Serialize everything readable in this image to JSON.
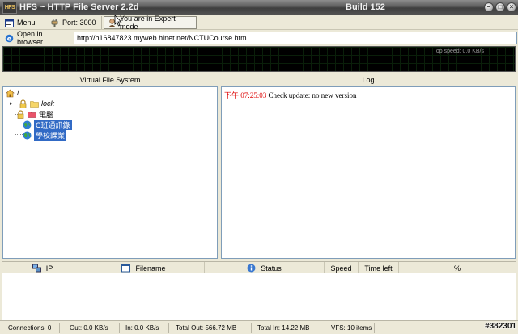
{
  "window": {
    "app_icon_text": "HFS",
    "title": "HFS ~ HTTP File Server 2.2d",
    "build": "Build 152"
  },
  "toolbar": {
    "menu_label": "Menu",
    "port_label": "Port: 3000",
    "mode_label": "You are in Expert mode"
  },
  "urlbar": {
    "open_label": "Open in browser",
    "url_value": "http://h16847823.myweb.hinet.net/NCTUCourse.htm"
  },
  "graph": {
    "speed_text": "Top speed: 0.0 KB/s"
  },
  "vfs": {
    "header": "Virtual File System",
    "root": "/",
    "items": [
      {
        "label": "lock",
        "icon": "locked-folder-icon",
        "italic": true,
        "selected": false
      },
      {
        "label": "電腦",
        "icon": "locked-folder-red-icon",
        "italic": false,
        "selected": false
      },
      {
        "label": "C班通訊錄",
        "icon": "globe-icon",
        "italic": false,
        "selected": true
      },
      {
        "label": "學校課業",
        "icon": "globe-icon",
        "italic": false,
        "selected": true
      }
    ]
  },
  "log": {
    "header": "Log",
    "entries": [
      {
        "time": "下午 07:25:03",
        "message": "Check update: no new version"
      }
    ]
  },
  "connections": {
    "columns": [
      {
        "label": "IP",
        "icon": "network-icon"
      },
      {
        "label": "Filename",
        "icon": "file-window-icon"
      },
      {
        "label": "Status",
        "icon": "info-icon"
      },
      {
        "label": "Speed",
        "icon": ""
      },
      {
        "label": "Time left",
        "icon": ""
      },
      {
        "label": "%",
        "icon": ""
      }
    ]
  },
  "statusbar": {
    "connections": "Connections: 0",
    "out": "Out: 0.0 KB/s",
    "in": "In: 0.0 KB/s",
    "total_out": "Total Out: 566.72 MB",
    "total_in": "Total In: 14.22 MB",
    "vfs": "VFS: 10 items",
    "watermark": "#382301"
  },
  "colors": {
    "selection": "#316ac5",
    "log_time": "#dd0000",
    "graph_bg": "#000000"
  }
}
